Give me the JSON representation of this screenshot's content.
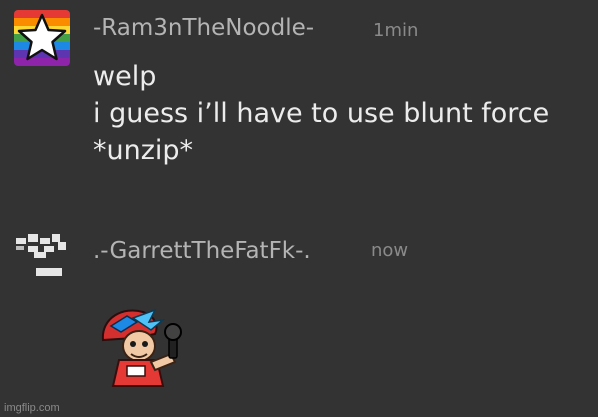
{
  "messages": [
    {
      "username": "-Ram3nTheNoodle-",
      "timestamp": "1min",
      "avatar_icon": "rainbow-star-icon",
      "lines": [
        "welp",
        "i guess i’ll have to use blunt force",
        "*unzip*"
      ]
    },
    {
      "username": ".-GarrettTheFatFk-.",
      "timestamp": "now",
      "avatar_icon": "pixel-blocks-icon",
      "sticker_icon": "boyfriend-sticker-icon"
    }
  ],
  "watermark": "imgflip.com",
  "colors": {
    "background": "#333333",
    "username": "#b4b4b4",
    "timestamp": "#8a8a8a",
    "body": "#ececec"
  }
}
